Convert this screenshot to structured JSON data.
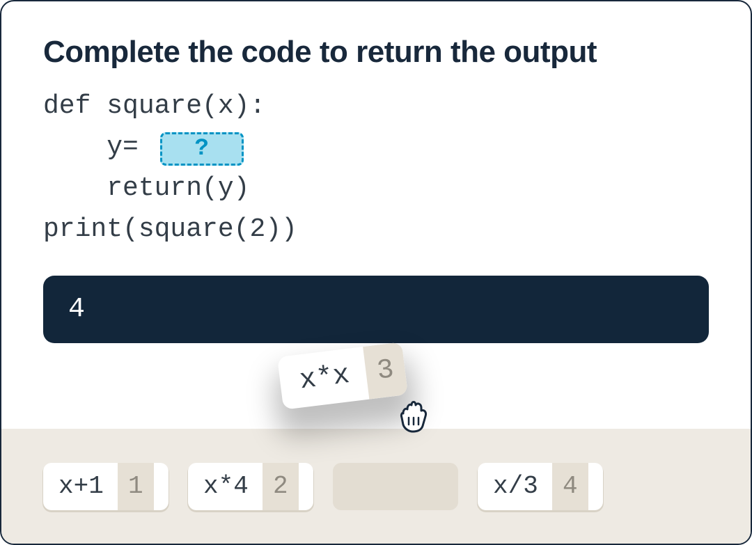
{
  "heading": "Complete the code to return the output",
  "code": {
    "line1": "def square(x):",
    "line2_prefix": "    y= ",
    "line2_placeholder": "?",
    "line3": "    return(y)",
    "line4": "print(square(2))"
  },
  "output": "4",
  "options": [
    {
      "label": "x+1",
      "number": "1"
    },
    {
      "label": "x*4",
      "number": "2"
    },
    {
      "label": "x*x",
      "number": "3",
      "dragging": true
    },
    {
      "label": "x/3",
      "number": "4"
    }
  ],
  "colors": {
    "drop_border": "#0093c4",
    "drop_fill": "#a8e0f0",
    "output_bg": "#12263a",
    "tray_bg": "#eeeae3"
  }
}
